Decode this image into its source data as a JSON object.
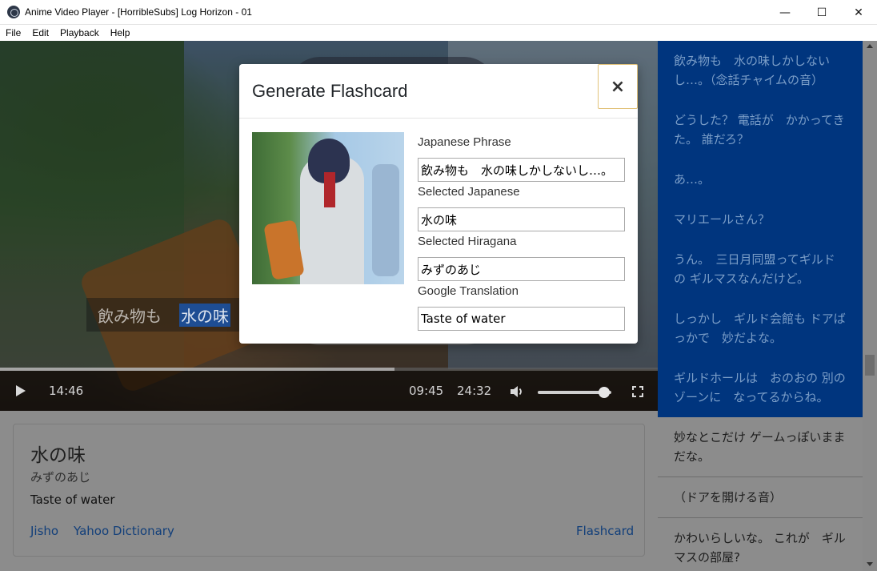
{
  "window": {
    "title": "Anime Video Player - [HorribleSubs] Log Horizon - 01",
    "minimize": "—",
    "maximize": "☐",
    "close": "✕"
  },
  "menu": [
    "File",
    "Edit",
    "Playback",
    "Help"
  ],
  "video": {
    "subtitle_before": "飲み物も",
    "subtitle_highlight": "水の味",
    "current_time": "14:46",
    "remaining_time": "09:45",
    "total_time": "24:32",
    "progress": 0.6,
    "volume": 0.9
  },
  "word_card": {
    "word": "水の味",
    "reading": "みずのあじ",
    "translation": "Taste of water",
    "link_jisho": "Jisho",
    "link_yahoo": "Yahoo Dictionary",
    "link_flashcard": "Flashcard"
  },
  "subtitles": [
    {
      "text": "飲み物も　水の味しかしないし…。（念話チャイムの音）",
      "active": true
    },
    {
      "text": "どうした？ 電話が　かかってきた。 誰だろ？",
      "active": true
    },
    {
      "text": "あ…。",
      "active": true
    },
    {
      "text": "マリエールさん？",
      "active": true
    },
    {
      "text": "うん。　三日月同盟ってギルドの ギルマスなんだけど。",
      "active": true
    },
    {
      "text": "しっかし　ギルド会館も ドアばっかで　妙だよな。",
      "active": true
    },
    {
      "text": "ギルドホールは　おのおの 別のゾーンに　なってるからね。",
      "active": true
    },
    {
      "text": "妙なとこだけ ゲームっぽいままだな。",
      "active": false
    },
    {
      "text": "（ドアを開ける音）",
      "active": false
    },
    {
      "text": "かわいらしいな。 これが　ギルマスの部屋?",
      "active": false
    }
  ],
  "modal": {
    "title": "Generate Flashcard",
    "close": "×",
    "japanese_phrase_label": "Japanese Phrase",
    "japanese_phrase_value": "飲み物も　水の味しかしないし…。",
    "selected_japanese_label": "Selected Japanese",
    "selected_japanese_value": "水の味",
    "selected_hiragana_label": "Selected Hiragana",
    "selected_hiragana_value": "みずのあじ",
    "google_translation_label": "Google Translation",
    "google_translation_value": "Taste of water"
  }
}
